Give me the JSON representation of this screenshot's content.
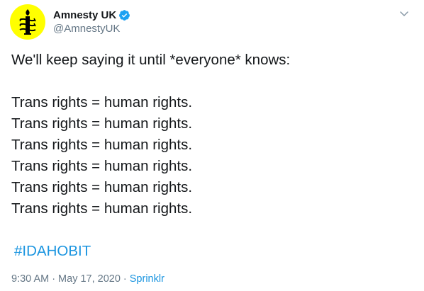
{
  "author": {
    "display_name": "Amnesty UK",
    "handle": "@AmnestyUK",
    "verified": true,
    "avatar_icon": "amnesty-candle-icon",
    "avatar_color": "#ffff00"
  },
  "menu": {
    "icon": "chevron-down-icon"
  },
  "tweet": {
    "intro": "We'll keep saying it until *everyone* knows:",
    "lines": [
      "Trans rights = human rights.",
      "Trans rights = human rights.",
      "Trans rights = human rights.",
      "Trans rights = human rights.",
      "Trans rights = human rights.",
      "Trans rights = human rights."
    ],
    "hashtag": "#IDAHOBIT"
  },
  "meta": {
    "time": "9:30 AM",
    "separator": "·",
    "date": "May 17, 2020",
    "source": "Sprinklr"
  },
  "colors": {
    "link": "#1b95e0",
    "secondary_text": "#657786",
    "primary_text": "#14171a",
    "verified_badge": "#1da1f2"
  }
}
